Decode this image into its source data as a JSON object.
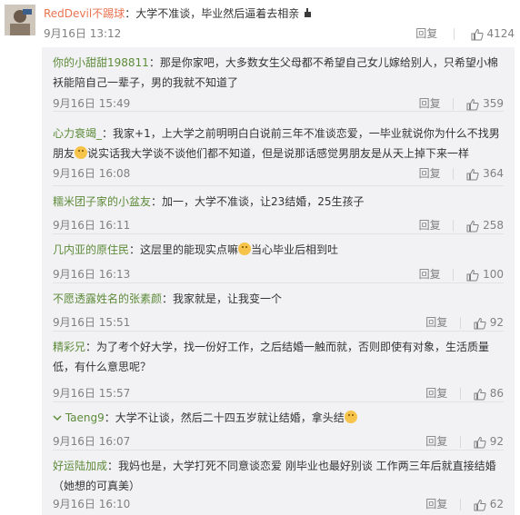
{
  "top_comment": {
    "username": "RedDevil不踢球",
    "text": "：大学不准谈，毕业然后逼着去相亲",
    "time": "9月16日 13:12",
    "reply_label": "回复",
    "likes": "4124"
  },
  "replies": [
    {
      "username": "你的小甜甜198811",
      "text": "：那是你家吧，大多数女生父母都不希望自己女儿嫁给别人，只希望小棉袄能陪自己一辈子，男的我就不知道了",
      "time": "9月16日 15:49",
      "reply_label": "回复",
      "likes": "359"
    },
    {
      "username": "心力衰竭_",
      "text_a": "：我家+1，上大学之前明明白白说前三年不准谈恋爱，一毕业就说你为什么不找男朋友",
      "text_b": "说实话我大学谈不谈他们都不知道，但是说那话感觉男朋友是从天上掉下来一样",
      "time": "9月16日 16:08",
      "reply_label": "回复",
      "likes": "364"
    },
    {
      "username": "糯米团子家的小盆友",
      "text": "：加一，大学不准谈，让23结婚，25生孩子",
      "time": "9月16日 16:11",
      "reply_label": "回复",
      "likes": "258"
    },
    {
      "username": "几内亚的原住民",
      "text_a": "：这层里的能现实点嘛",
      "text_b": "当心毕业后相到吐",
      "time": "9月16日 16:13",
      "reply_label": "回复",
      "likes": "100"
    },
    {
      "username": "不愿透露姓名的张素颜",
      "text": "：我家就是，让我变一个",
      "time": "9月16日 15:51",
      "reply_label": "回复",
      "likes": "92"
    },
    {
      "username": "精彩兄",
      "text": "：为了考个好大学，找一份好工作，之后结婚一触而就，否则即使有对象，生活质量低，有什么意思呢？",
      "time": "9月16日 15:57",
      "reply_label": "回复",
      "likes": "86"
    },
    {
      "username": "Taeng9",
      "text": "：大学不让谈，然后二十四五岁就让结婚，拿头结",
      "time": "9月16日 16:07",
      "reply_label": "回复",
      "likes": "92"
    },
    {
      "username": "好运陆加成",
      "text": "：我妈也是，大学打死不同意谈恋爱 刚毕业也最好别谈 工作两三年后就直接结婚（她想的可真美）",
      "time": "9月16日 16:10",
      "reply_label": "回复",
      "likes": "62"
    }
  ],
  "colors": {
    "name": "#eb7350",
    "sub_name": "#5d8b39",
    "box_bg": "#f2f2f5"
  },
  "icons": {
    "like": "thumbs-up-icon",
    "emoji": "smile-emoji-icon",
    "hand": "hand-emoji-icon",
    "verified": "verified-arrow-icon"
  }
}
